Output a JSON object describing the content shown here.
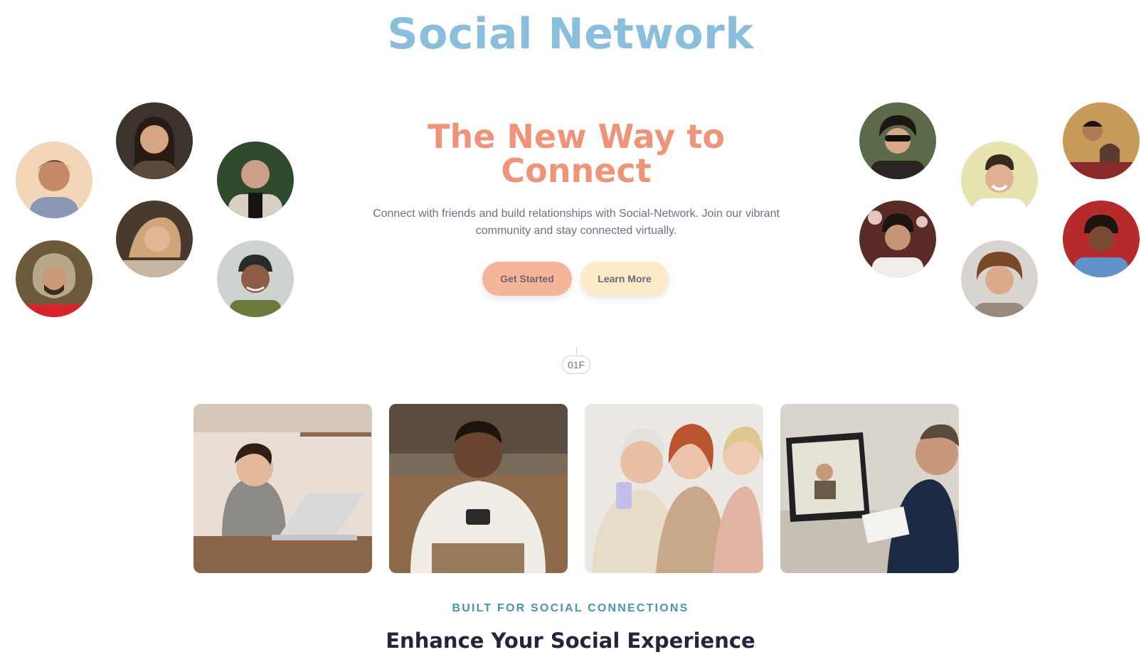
{
  "header": {
    "title": "Social Network"
  },
  "hero": {
    "heading": "The New Way to Connect",
    "description": "Connect with friends and build relationships with Social-Network. Join our vibrant community and stay connected virtually.",
    "primary_button": "Get Started",
    "secondary_button": "Learn More"
  },
  "marker": {
    "label": "01F"
  },
  "features": {
    "eyebrow": "BUILT FOR SOCIAL CONNECTIONS",
    "title": "Enhance Your Social Experience"
  },
  "colors": {
    "title_blue": "#89bfdd",
    "heading_coral": "#ee9478",
    "button_primary": "#f4b59a",
    "button_secondary": "#fdeac8",
    "eyebrow_teal": "#4c93ac",
    "section_title": "#23253a"
  },
  "avatars": {
    "left": [
      "person-avatar",
      "person-avatar",
      "person-avatar",
      "person-avatar",
      "person-avatar",
      "person-avatar"
    ],
    "right": [
      "person-avatar",
      "person-avatar",
      "person-avatar",
      "person-avatar",
      "person-avatar",
      "person-avatar"
    ]
  },
  "photos": [
    "woman-laptop-photo",
    "man-phone-photo",
    "women-group-phone-photo",
    "video-call-photo"
  ]
}
